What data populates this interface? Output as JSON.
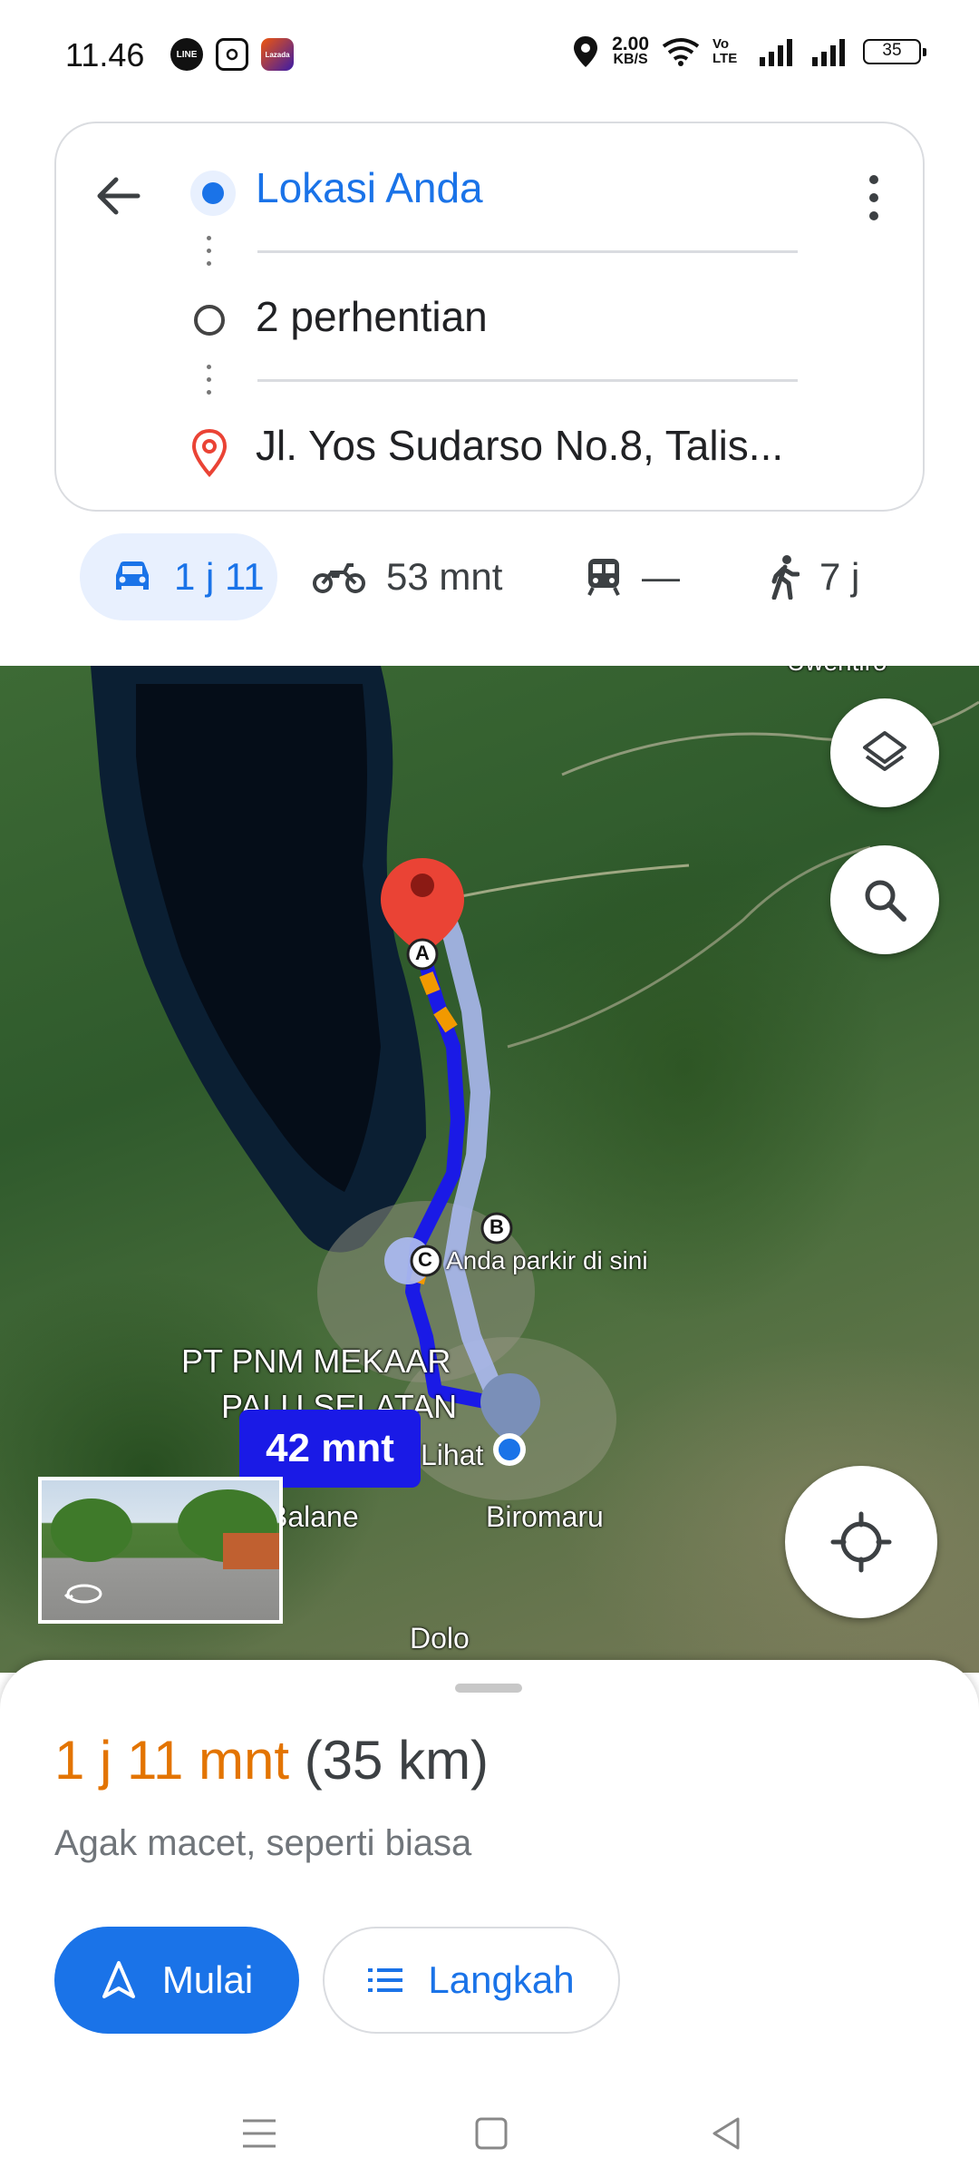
{
  "status_bar": {
    "time": "11.46",
    "apps": [
      "LINE",
      "Instagram",
      "Lazada"
    ],
    "net_speed_value": "2.00",
    "net_speed_unit": "KB/S",
    "volte": "Vo LTE",
    "battery": "35"
  },
  "directions": {
    "origin": "Lokasi Anda",
    "stops": "2 perhentian",
    "destination": "Jl. Yos Sudarso No.8, Talis..."
  },
  "modes": [
    {
      "name": "car",
      "label": "1 j 11",
      "active": true
    },
    {
      "name": "motorcycle",
      "label": "53 mnt"
    },
    {
      "name": "transit",
      "label": "—"
    },
    {
      "name": "walk",
      "label": "7 j"
    }
  ],
  "map": {
    "labels": {
      "top_right": "Uwentiro",
      "parking": "Anda parkir di sini",
      "poi_line1": "PT PNM MEKAAR",
      "poi_line2": "PALU SELATAN",
      "sibalaya": "Lihat",
      "balane": "Balane",
      "biromaru": "Biromaru",
      "dolo": "Dolo"
    },
    "markers": {
      "a": "A",
      "b": "B",
      "c": "C"
    },
    "eta_badge": "42 mnt",
    "colors": {
      "route": "#1a1ae6",
      "alt_route": "#aab8ee",
      "pin": "#ea4335"
    }
  },
  "sheet": {
    "duration": "1 j 11 mnt",
    "distance": "(35 km)",
    "traffic": "Agak macet, seperti biasa",
    "start_label": "Mulai",
    "steps_label": "Langkah"
  },
  "colors": {
    "accent": "#1a73e8",
    "time": "#e37400"
  }
}
